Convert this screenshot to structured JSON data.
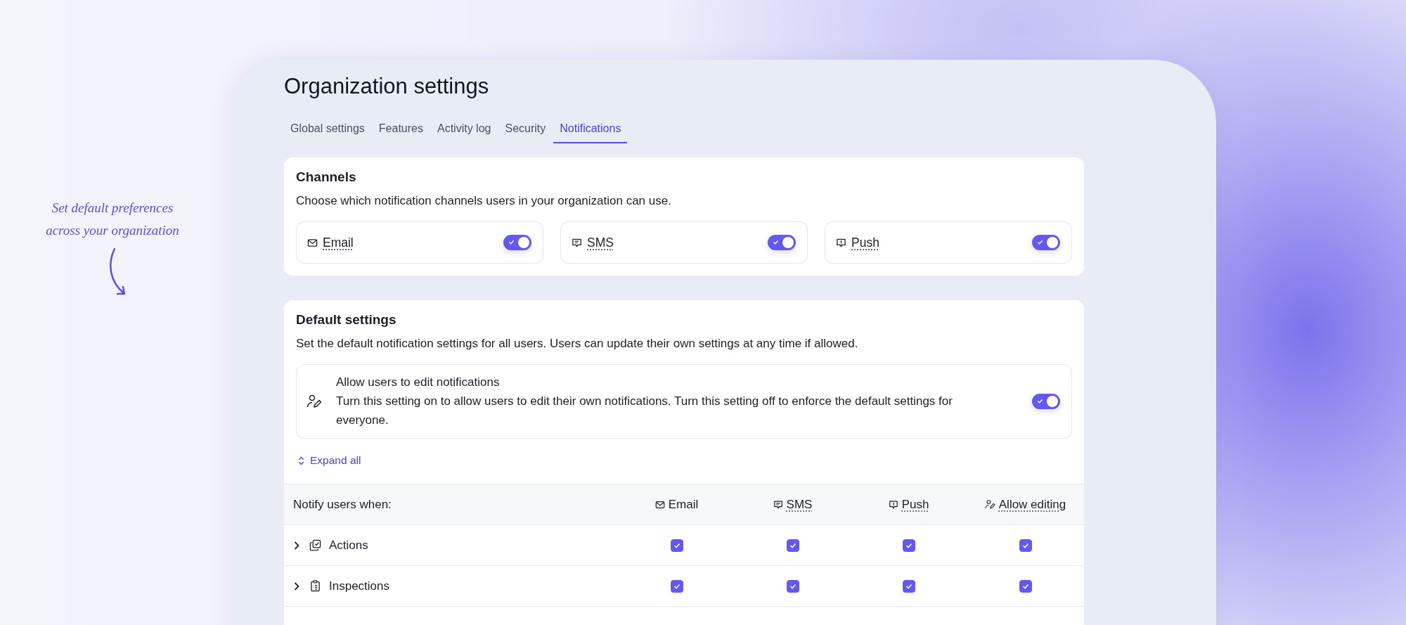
{
  "annotation": {
    "text": "Set default preferences across your organization"
  },
  "page": {
    "title": "Organization settings"
  },
  "tabs": [
    {
      "label": "Global settings",
      "selected": false
    },
    {
      "label": "Features",
      "selected": false
    },
    {
      "label": "Activity log",
      "selected": false
    },
    {
      "label": "Security",
      "selected": false
    },
    {
      "label": "Notifications",
      "selected": true
    }
  ],
  "channels_card": {
    "title": "Channels",
    "description": "Choose which notification channels users in your organization can use.",
    "channels": [
      {
        "kind": "email",
        "name": "Email",
        "enabled": true
      },
      {
        "kind": "sms",
        "name": "SMS",
        "enabled": true
      },
      {
        "kind": "push",
        "name": "Push",
        "enabled": true
      }
    ]
  },
  "default_settings": {
    "title": "Default settings",
    "description": "Set the default notification settings for all users. Users can update their own settings at any time if allowed.",
    "allow_edit": {
      "title": "Allow users to edit notifications",
      "description": "Turn this setting on to allow users to edit their own notifications. Turn this setting off to enforce the default settings for everyone.",
      "on": true
    },
    "expand_all": "Expand all",
    "table": {
      "columns": [
        {
          "kind": "label",
          "label": "Notify users when:",
          "underlined": false
        },
        {
          "kind": "email",
          "label": "Email",
          "underlined": false
        },
        {
          "kind": "sms",
          "label": "SMS",
          "underlined": true
        },
        {
          "kind": "push",
          "label": "Push",
          "underlined": true
        },
        {
          "kind": "edit",
          "label": "Allow editing",
          "underlined": true
        }
      ],
      "rows": [
        {
          "kind": "actions",
          "name": "Actions",
          "expanded": false,
          "checks": [
            true,
            true,
            true,
            true
          ]
        },
        {
          "kind": "inspections",
          "name": "Inspections",
          "expanded": false,
          "checks": [
            true,
            true,
            true,
            true
          ]
        }
      ]
    }
  }
}
